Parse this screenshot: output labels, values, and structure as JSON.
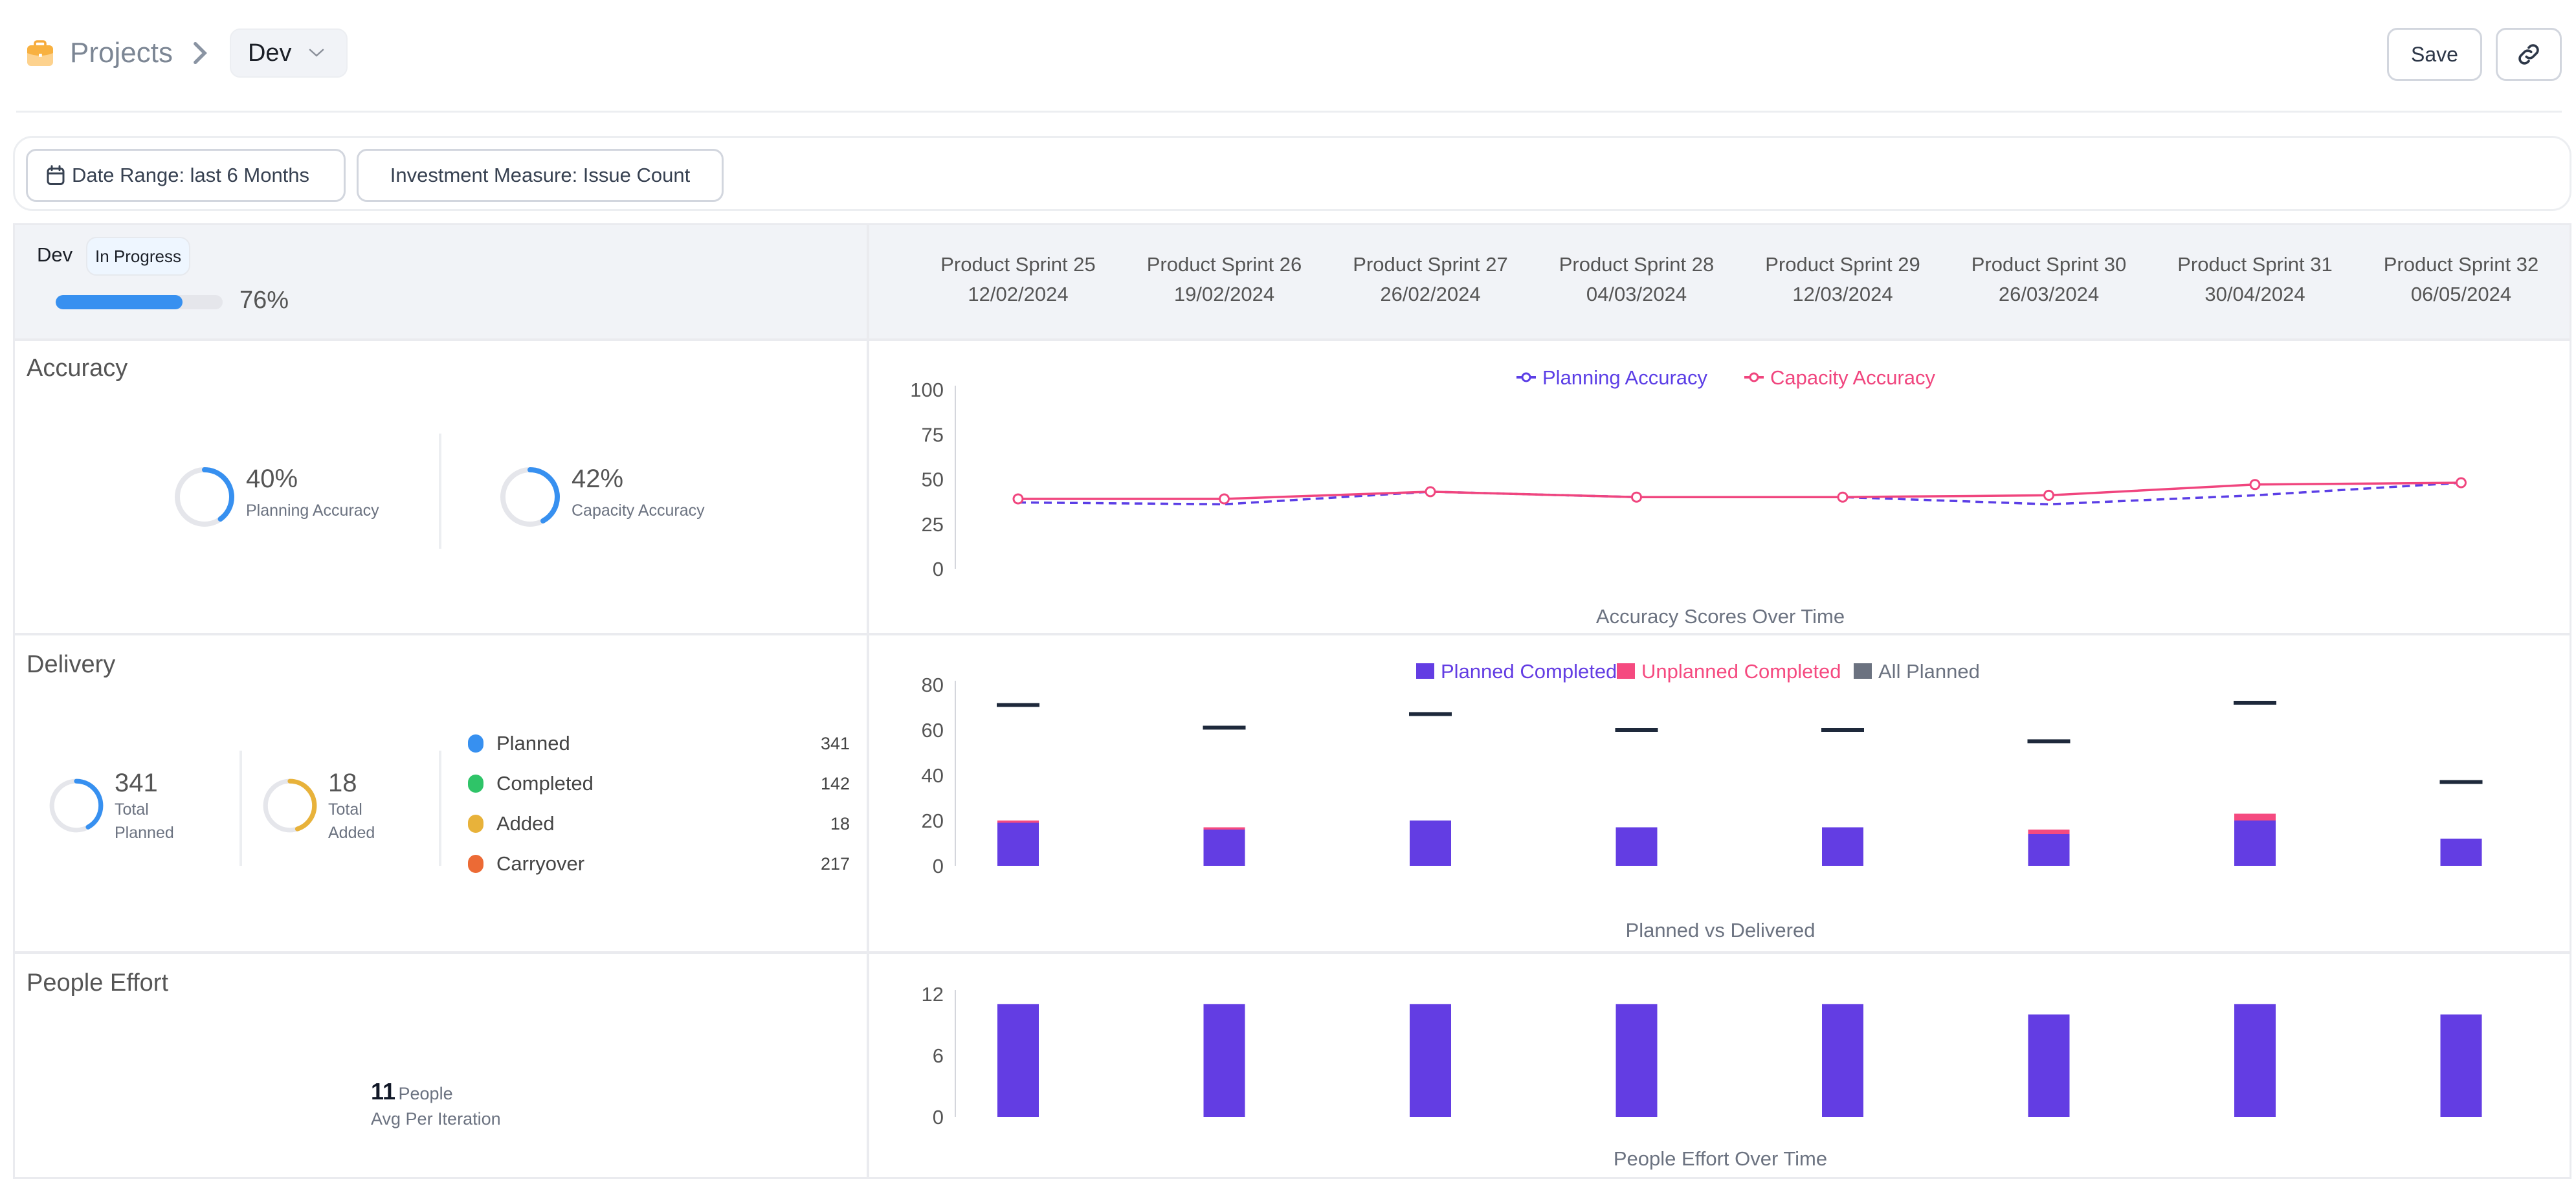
{
  "breadcrumb": {
    "root_icon": "briefcase-icon",
    "root_label": "Projects",
    "separator_icon": "chevron-right-icon",
    "current": "Dev",
    "dropdown_icon": "chevron-down-icon"
  },
  "toolbar": {
    "save_label": "Save",
    "link_icon": "link-icon"
  },
  "filters": {
    "date_range_icon": "calendar-icon",
    "date_range_label": "Date Range: last 6 Months",
    "investment_label": "Investment Measure: Issue Count"
  },
  "team": {
    "name": "Dev",
    "status": "In Progress",
    "progress_percent": 76,
    "progress_label": "76%"
  },
  "sprints": [
    {
      "name": "Product Sprint 25",
      "date": "12/02/2024"
    },
    {
      "name": "Product Sprint 26",
      "date": "19/02/2024"
    },
    {
      "name": "Product Sprint 27",
      "date": "26/02/2024"
    },
    {
      "name": "Product Sprint 28",
      "date": "04/03/2024"
    },
    {
      "name": "Product Sprint 29",
      "date": "12/03/2024"
    },
    {
      "name": "Product Sprint 30",
      "date": "26/03/2024"
    },
    {
      "name": "Product Sprint 31",
      "date": "30/04/2024"
    },
    {
      "name": "Product Sprint 32",
      "date": "06/05/2024"
    }
  ],
  "accuracy": {
    "title": "Accuracy",
    "planning": {
      "value": 40,
      "label_value": "40%",
      "label": "Planning Accuracy"
    },
    "capacity": {
      "value": 42,
      "label_value": "42%",
      "label": "Capacity Accuracy"
    }
  },
  "delivery": {
    "title": "Delivery",
    "total_planned": {
      "value": "341",
      "label1": "Total",
      "label2": "Planned",
      "fraction": 0.42
    },
    "total_added": {
      "value": "18",
      "label1": "Total",
      "label2": "Added",
      "fraction": 0.45
    },
    "legend": [
      {
        "label": "Planned",
        "value": "341",
        "color": "#3790f0"
      },
      {
        "label": "Completed",
        "value": "142",
        "color": "#2fc468"
      },
      {
        "label": "Added",
        "value": "18",
        "color": "#e8b23a"
      },
      {
        "label": "Carryover",
        "value": "217",
        "color": "#ec6a35"
      }
    ]
  },
  "people": {
    "title": "People Effort",
    "avg_value": "11",
    "avg_unit": "People",
    "avg_label": "Avg Per Iteration"
  },
  "colors": {
    "planning": "#5b3ee6",
    "capacity": "#f0457e",
    "planned_completed": "#633de3",
    "unplanned_completed": "#f54a80",
    "all_planned": "#1e293b",
    "all_planned_legend": "#6b7280",
    "ring_blue": "#3790f0",
    "ring_yellow": "#e8b23a"
  },
  "chart_data": [
    {
      "type": "line",
      "title": "Accuracy Scores Over Time",
      "categories": [
        "Product Sprint 25",
        "Product Sprint 26",
        "Product Sprint 27",
        "Product Sprint 28",
        "Product Sprint 29",
        "Product Sprint 30",
        "Product Sprint 31",
        "Product Sprint 32"
      ],
      "series": [
        {
          "name": "Planning Accuracy",
          "values": [
            37,
            36,
            43,
            40,
            40,
            36,
            41,
            48
          ],
          "style": "dashed"
        },
        {
          "name": "Capacity Accuracy",
          "values": [
            39,
            39,
            43,
            40,
            40,
            41,
            47,
            48
          ],
          "style": "solid"
        }
      ],
      "yticks": [
        0,
        25,
        50,
        75,
        100
      ],
      "ylim": [
        0,
        100
      ],
      "legend": "top-center",
      "grid": false
    },
    {
      "type": "bar",
      "title": "Planned vs Delivered",
      "stacked": true,
      "categories": [
        "Product Sprint 25",
        "Product Sprint 26",
        "Product Sprint 27",
        "Product Sprint 28",
        "Product Sprint 29",
        "Product Sprint 30",
        "Product Sprint 31",
        "Product Sprint 32"
      ],
      "series": [
        {
          "name": "Planned Completed",
          "values": [
            19,
            16,
            20,
            17,
            17,
            14,
            20,
            12
          ]
        },
        {
          "name": "Unplanned Completed",
          "values": [
            1,
            1,
            0,
            0,
            0,
            2,
            3,
            0
          ]
        },
        {
          "name": "All Planned",
          "values": [
            71,
            61,
            67,
            60,
            60,
            55,
            72,
            37
          ],
          "style": "marker-line"
        }
      ],
      "yticks": [
        0,
        20,
        40,
        60,
        80
      ],
      "ylim": [
        0,
        80
      ],
      "legend": "top-center",
      "grid": false
    },
    {
      "type": "bar",
      "title": "People Effort Over Time",
      "categories": [
        "Product Sprint 25",
        "Product Sprint 26",
        "Product Sprint 27",
        "Product Sprint 28",
        "Product Sprint 29",
        "Product Sprint 30",
        "Product Sprint 31",
        "Product Sprint 32"
      ],
      "series": [
        {
          "name": "People",
          "values": [
            11,
            11,
            11,
            11,
            11,
            10,
            11,
            10
          ]
        }
      ],
      "yticks": [
        0,
        6,
        12
      ],
      "ylim": [
        0,
        12
      ],
      "legend": "none",
      "grid": false
    }
  ]
}
